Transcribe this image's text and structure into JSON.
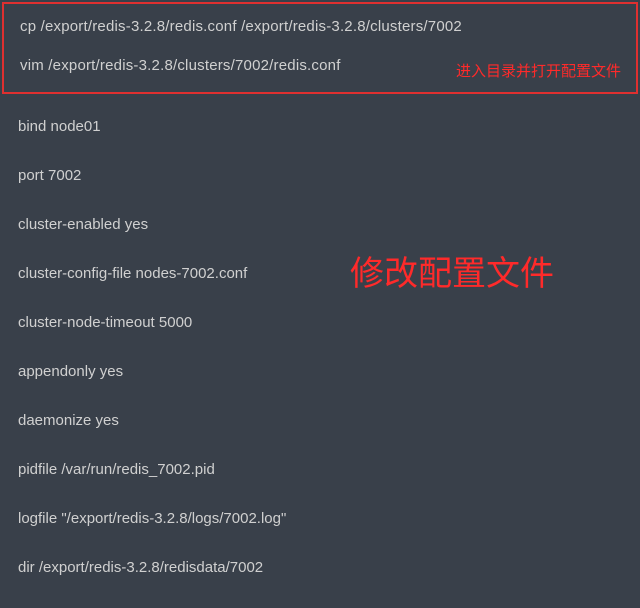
{
  "commands": {
    "cp": "cp /export/redis-3.2.8/redis.conf /export/redis-3.2.8/clusters/7002",
    "vim": "vim  /export/redis-3.2.8/clusters/7002/redis.conf",
    "vim_annotation": "进入目录并打开配置文件"
  },
  "config": {
    "lines": [
      "bind node01",
      "port 7002",
      "cluster-enabled yes",
      "cluster-config-file nodes-7002.conf",
      "cluster-node-timeout 5000",
      "appendonly yes",
      "daemonize yes",
      "pidfile /var/run/redis_7002.pid",
      "logfile \"/export/redis-3.2.8/logs/7002.log\"",
      "dir /export/redis-3.2.8/redisdata/7002"
    ],
    "big_label": "修改配置文件"
  }
}
